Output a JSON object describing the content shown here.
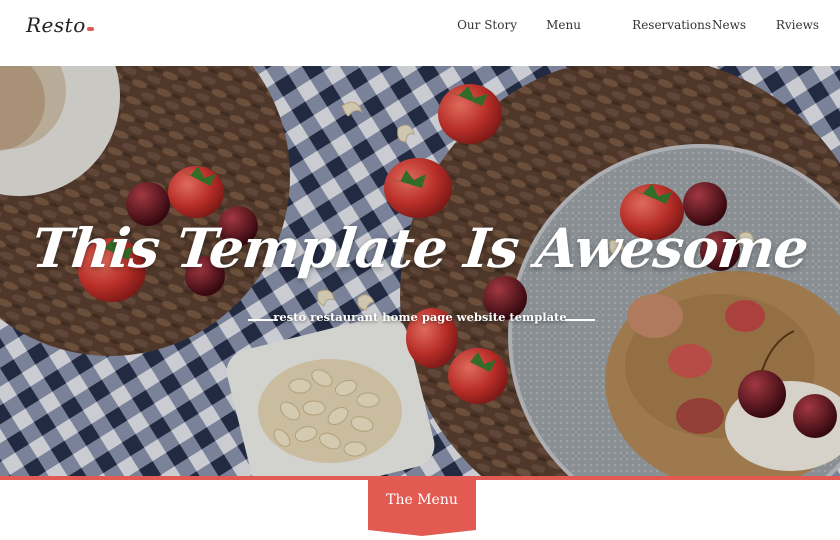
{
  "header": {
    "logo": "Resto",
    "nav": [
      "Our Story",
      "Menu",
      "Reservations",
      "News",
      "Rviews"
    ]
  },
  "hero": {
    "title": "This Template Is Awesome",
    "subtitle": "resto restaurant home page website template"
  },
  "section_tab": {
    "label": "The Menu"
  },
  "colors": {
    "accent": "#e35a52",
    "text": "#333333",
    "background": "#ffffff"
  }
}
